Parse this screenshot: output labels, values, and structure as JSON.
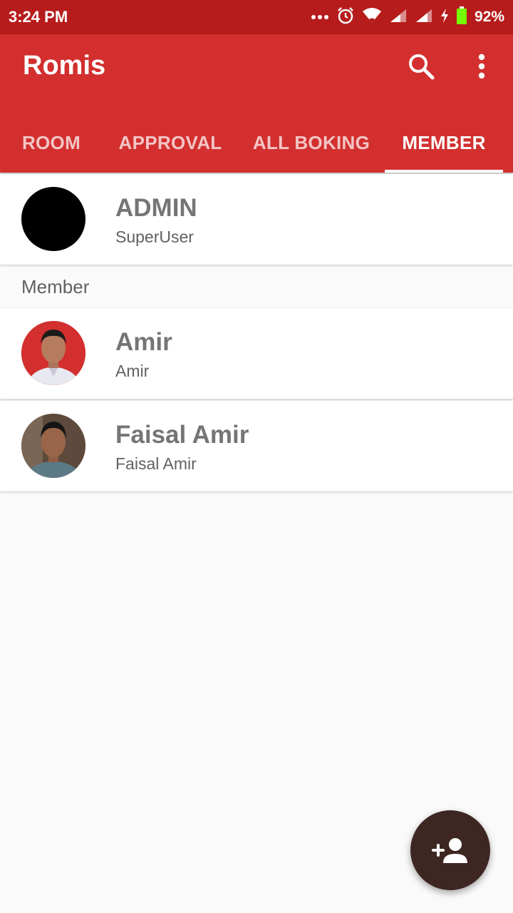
{
  "status_bar": {
    "time": "3:24 PM",
    "battery_percent": "92%",
    "icons": [
      "more-dots-icon",
      "alarm-icon",
      "wifi-icon",
      "signal-icon",
      "signal-icon",
      "charging-icon",
      "battery-icon"
    ]
  },
  "app_bar": {
    "title": "Romis",
    "actions": [
      "search-icon",
      "more-vert-icon"
    ],
    "color": "#d32f2f",
    "status_color": "#b71c1c"
  },
  "tabs": [
    {
      "label": "ROOM",
      "active": false
    },
    {
      "label": "APPROVAL",
      "active": false
    },
    {
      "label": "ALL BOKING",
      "active": false
    },
    {
      "label": "MEMBER",
      "active": true
    }
  ],
  "admin": {
    "name": "ADMIN",
    "role": "SuperUser"
  },
  "section": {
    "label": "Member"
  },
  "members": [
    {
      "name": "Amir",
      "username": "Amir"
    },
    {
      "name": "Faisal Amir",
      "username": "Faisal Amir"
    }
  ],
  "fab": {
    "icon": "add-person-icon",
    "color": "#3e2723"
  }
}
